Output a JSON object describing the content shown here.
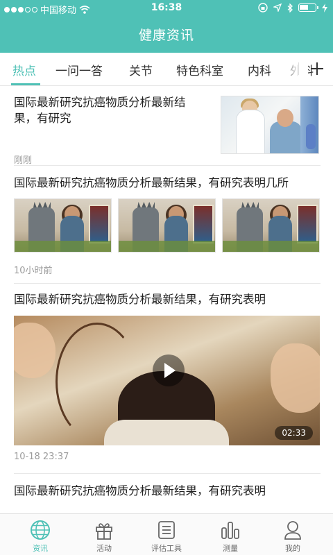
{
  "status_bar": {
    "carrier": "中国移动",
    "time": "16:38"
  },
  "header": {
    "title": "健康资讯"
  },
  "tabs": [
    {
      "label": "热点",
      "active": true
    },
    {
      "label": "一问一答",
      "active": false
    },
    {
      "label": "关节",
      "active": false
    },
    {
      "label": "特色科室",
      "active": false
    },
    {
      "label": "内科",
      "active": false
    },
    {
      "label": "外科",
      "active": false
    }
  ],
  "feed": {
    "items": [
      {
        "title": "国际最新研究抗癌物质分析最新结果，有研究",
        "time": "刚刚",
        "layout": "right-thumbnail"
      },
      {
        "title": "国际最新研究抗癌物质分析最新结果，有研究表明几所",
        "time": "10小时前",
        "layout": "three-images"
      },
      {
        "title": "国际最新研究抗癌物质分析最新结果，有研究表明",
        "time": "10-18 23:37",
        "layout": "video",
        "duration": "02:33"
      },
      {
        "title": "国际最新研究抗癌物质分析最新结果，有研究表明"
      }
    ]
  },
  "bottom_nav": [
    {
      "label": "资讯",
      "icon": "globe-icon",
      "active": true
    },
    {
      "label": "活动",
      "icon": "gift-icon",
      "active": false
    },
    {
      "label": "评估工具",
      "icon": "list-icon",
      "active": false
    },
    {
      "label": "测量",
      "icon": "bar-chart-icon",
      "active": false
    },
    {
      "label": "我的",
      "icon": "user-icon",
      "active": false
    }
  ],
  "colors": {
    "accent": "#4fc1b6",
    "text": "#333333",
    "meta": "#9a9a9a"
  }
}
